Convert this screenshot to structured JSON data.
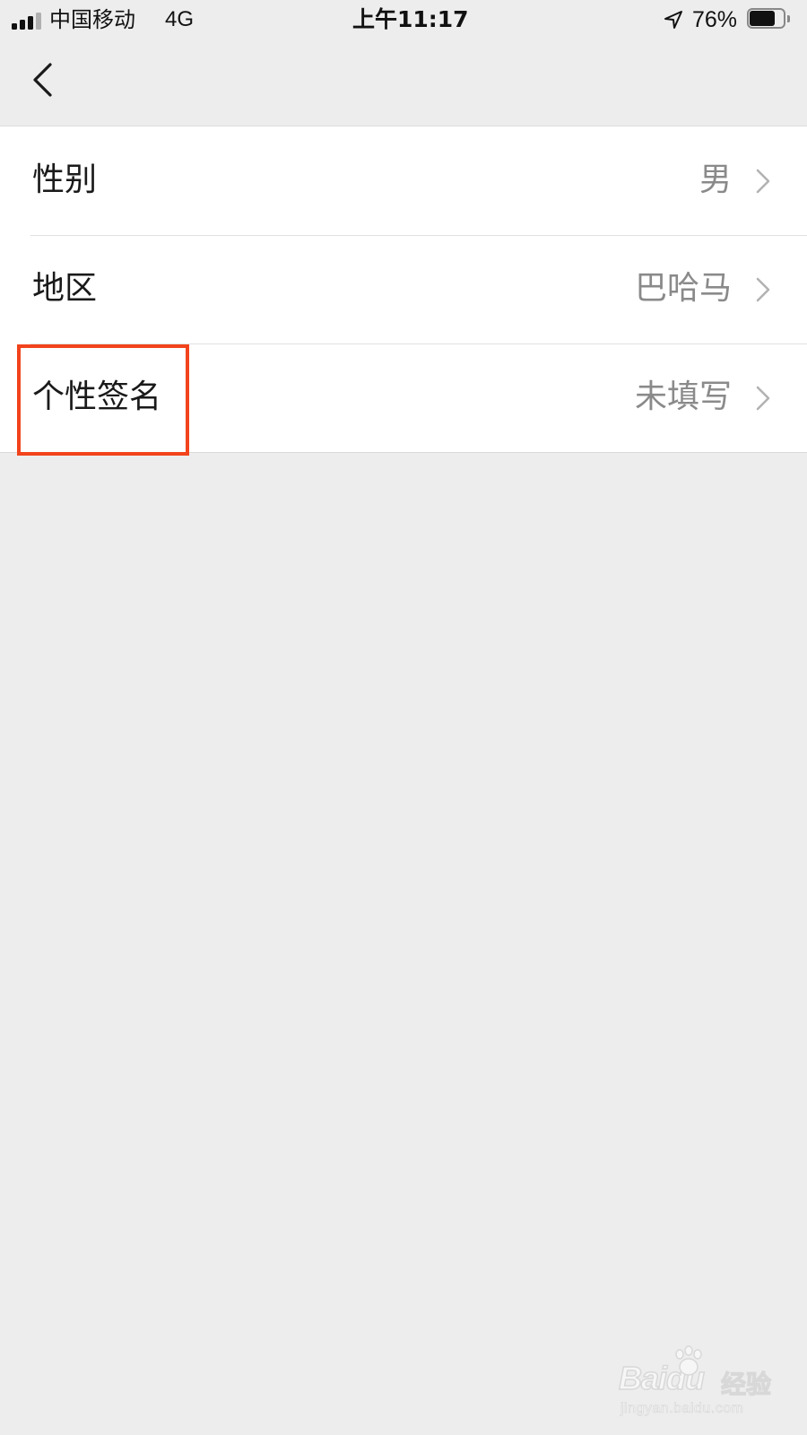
{
  "status_bar": {
    "carrier": "中国移动",
    "network": "4G",
    "time": "上午11:17",
    "battery_percent_text": "76%",
    "battery_level": 0.76,
    "signal_bars_filled": 3,
    "signal_bars_total": 4,
    "icons": [
      "signal-icon",
      "location-arrow-icon",
      "battery-icon"
    ]
  },
  "nav": {
    "back_icon": "chevron-left-icon"
  },
  "settings": [
    {
      "label": "性别",
      "value": "男"
    },
    {
      "label": "地区",
      "value": "巴哈马"
    },
    {
      "label": "个性签名",
      "value": "未填写"
    }
  ],
  "highlight": {
    "color": "#f2431c",
    "target": "个性签名"
  },
  "watermark": {
    "logo": "Baidu",
    "suffix": "经验",
    "url": "jingyan.baidu.com"
  },
  "colors": {
    "background": "#ededed",
    "list_background": "#ffffff",
    "value_text": "#8a8a8a"
  }
}
